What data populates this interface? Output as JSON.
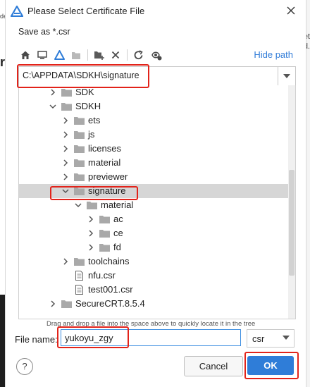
{
  "dialog": {
    "title": "Please Select Certificate File",
    "subtitle": "Save as *.csr",
    "hide_path_label": "Hide path",
    "path_value": "C:\\APPDATA\\SDKH\\signature",
    "drag_hint": "Drag and drop a file into the space above to quickly locate it in the tree",
    "file_name_label": "File name:",
    "file_name_value": "yukoyu_zgy",
    "file_type_value": "csr",
    "help_label": "?",
    "cancel_label": "Cancel",
    "ok_label": "OK"
  },
  "tree": [
    {
      "label": "SDK",
      "type": "folder",
      "state": "collapsed",
      "selected": false
    },
    {
      "label": "SDKH",
      "type": "folder",
      "state": "expanded",
      "selected": false
    },
    {
      "label": "ets",
      "type": "folder",
      "state": "collapsed",
      "selected": false
    },
    {
      "label": "js",
      "type": "folder",
      "state": "collapsed",
      "selected": false
    },
    {
      "label": "licenses",
      "type": "folder",
      "state": "collapsed",
      "selected": false
    },
    {
      "label": "material",
      "type": "folder",
      "state": "collapsed",
      "selected": false
    },
    {
      "label": "previewer",
      "type": "folder",
      "state": "collapsed",
      "selected": false
    },
    {
      "label": "signature",
      "type": "folder",
      "state": "expanded",
      "selected": true
    },
    {
      "label": "material",
      "type": "folder",
      "state": "expanded",
      "selected": false
    },
    {
      "label": "ac",
      "type": "folder",
      "state": "collapsed",
      "selected": false
    },
    {
      "label": "ce",
      "type": "folder",
      "state": "collapsed",
      "selected": false
    },
    {
      "label": "fd",
      "type": "folder",
      "state": "collapsed",
      "selected": false
    },
    {
      "label": "toolchains",
      "type": "folder",
      "state": "collapsed",
      "selected": false
    },
    {
      "label": "nfu.csr",
      "type": "file",
      "state": "none",
      "selected": false
    },
    {
      "label": "test001.csr",
      "type": "file",
      "state": "none",
      "selected": false
    },
    {
      "label": "SecureCRT.8.5.4",
      "type": "folder",
      "state": "collapsed",
      "selected": false
    }
  ],
  "background_fragments": [
    "de",
    "et",
    "d."
  ],
  "colors": {
    "accent": "#2f7dd8",
    "highlight": "#e2231a",
    "selection": "#d6d6d6"
  }
}
